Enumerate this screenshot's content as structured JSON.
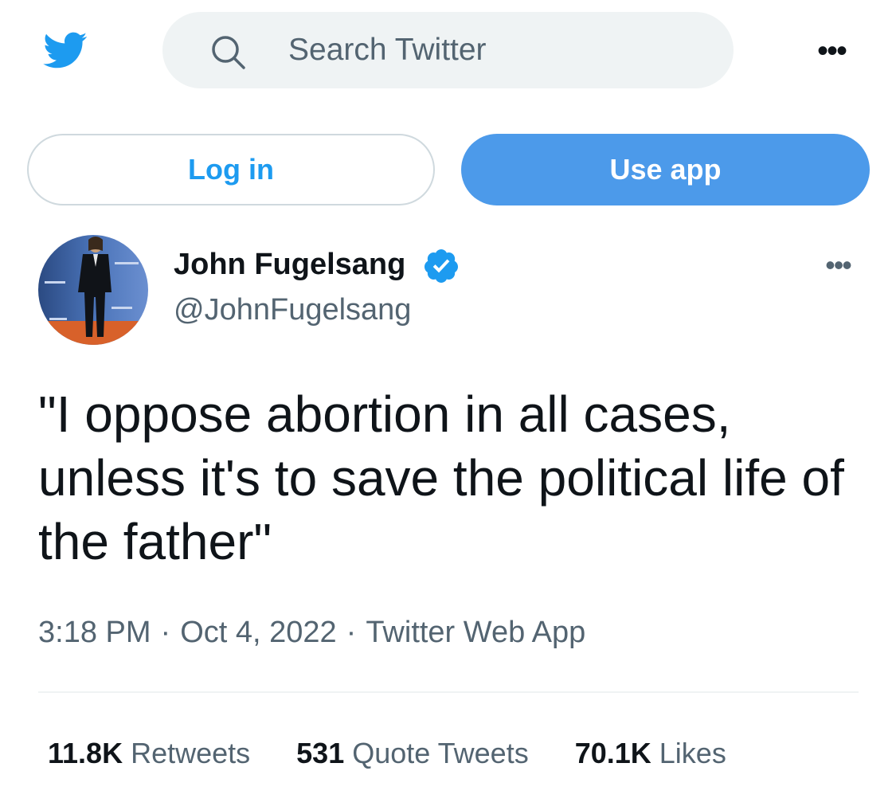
{
  "header": {
    "logo_icon": "twitter-bird-icon",
    "search_icon": "search-icon",
    "search_placeholder": "Search Twitter",
    "more_icon": "more-horizontal-icon"
  },
  "auth": {
    "login_label": "Log in",
    "use_app_label": "Use app"
  },
  "tweet": {
    "author_name": "John Fugelsang",
    "verified_icon": "verified-badge-icon",
    "handle": "@JohnFugelsang",
    "more_icon": "more-horizontal-icon",
    "text": "\"I oppose abortion in all cases, unless it's to save the political life of the father\"",
    "time": "3:18 PM",
    "date": "Oct 4, 2022",
    "source": "Twitter Web App",
    "separator": "·",
    "stats": {
      "retweets_count": "11.8K",
      "retweets_label": "Retweets",
      "quotes_count": "531",
      "quotes_label": "Quote Tweets",
      "likes_count": "70.1K",
      "likes_label": "Likes"
    }
  },
  "colors": {
    "brand_blue": "#1d9bf0",
    "use_app_blue": "#4c9aea",
    "text_primary": "#0f1419",
    "text_secondary": "#536471",
    "search_bg": "#eff3f4"
  }
}
